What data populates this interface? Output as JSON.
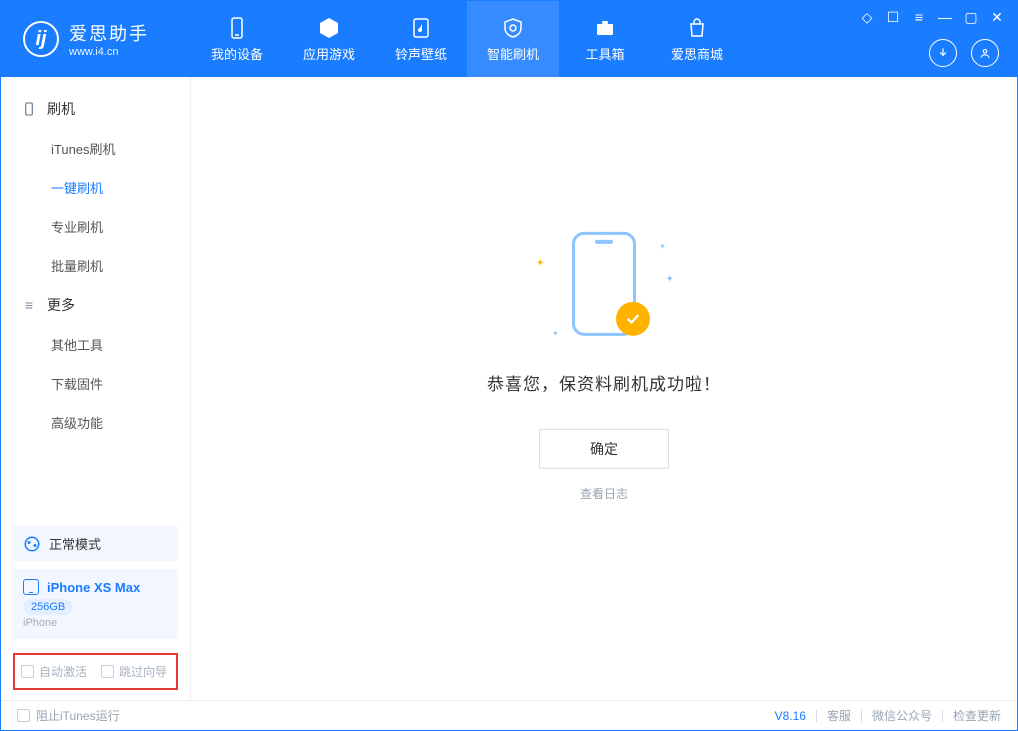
{
  "brand": {
    "name": "爱思助手",
    "url": "www.i4.cn",
    "logo_letter": "ij"
  },
  "tabs": {
    "device": "我的设备",
    "apps": "应用游戏",
    "ringtones": "铃声壁纸",
    "flash": "智能刷机",
    "toolbox": "工具箱",
    "store": "爱思商城"
  },
  "sidebar": {
    "group_flash": "刷机",
    "items_flash": {
      "itunes": "iTunes刷机",
      "oneclick": "一键刷机",
      "pro": "专业刷机",
      "batch": "批量刷机"
    },
    "group_more": "更多",
    "items_more": {
      "other_tools": "其他工具",
      "download_firmware": "下载固件",
      "advanced": "高级功能"
    }
  },
  "device": {
    "mode": "正常模式",
    "name": "iPhone XS Max",
    "storage": "256GB",
    "subtype": "iPhone"
  },
  "options": {
    "auto_activate": "自动激活",
    "skip_guide": "跳过向导"
  },
  "result": {
    "message": "恭喜您，保资料刷机成功啦！",
    "ok": "确定",
    "view_log": "查看日志"
  },
  "statusbar": {
    "block_itunes": "阻止iTunes运行",
    "version": "V8.16",
    "support": "客服",
    "wechat": "微信公众号",
    "check_update": "检查更新"
  }
}
